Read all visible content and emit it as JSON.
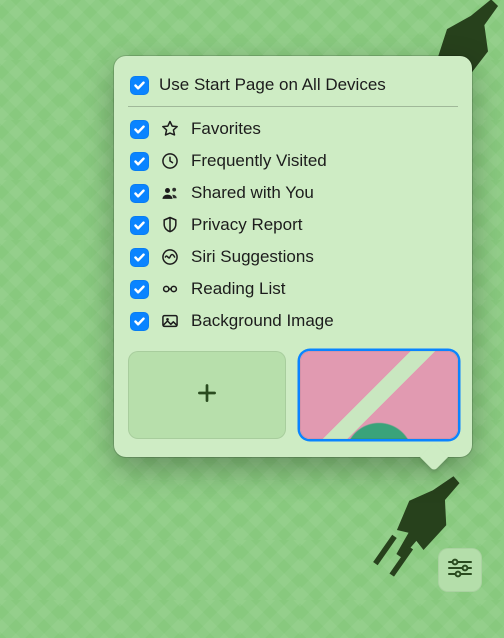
{
  "popover": {
    "use_all_devices": {
      "label": "Use Start Page on All Devices",
      "checked": true
    },
    "options": [
      {
        "id": "favorites",
        "label": "Favorites",
        "icon": "star-icon",
        "checked": true
      },
      {
        "id": "frequently_visited",
        "label": "Frequently Visited",
        "icon": "clock-icon",
        "checked": true
      },
      {
        "id": "shared_with_you",
        "label": "Shared with You",
        "icon": "people-icon",
        "checked": true
      },
      {
        "id": "privacy_report",
        "label": "Privacy Report",
        "icon": "shield-icon",
        "checked": true
      },
      {
        "id": "siri_suggestions",
        "label": "Siri Suggestions",
        "icon": "siri-icon",
        "checked": true
      },
      {
        "id": "reading_list",
        "label": "Reading List",
        "icon": "glasses-icon",
        "checked": true
      },
      {
        "id": "background_image",
        "label": "Background Image",
        "icon": "image-icon",
        "checked": true
      }
    ],
    "thumbnails": {
      "add_label": "Add Background",
      "selected_thumbnail": "butterfly-green"
    }
  },
  "settings_button": {
    "label": "Customize Start Page"
  },
  "colors": {
    "accent": "#0a84ff",
    "panel_bg": "#ceecc4",
    "page_bg": "#88c97e"
  }
}
